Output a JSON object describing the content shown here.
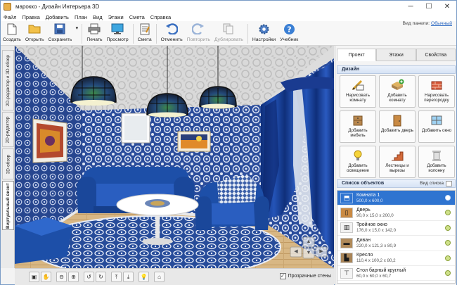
{
  "window": {
    "title": "марокко - Дизайн Интерьера 3D",
    "minimize": "─",
    "maximize": "☐",
    "close": "✕"
  },
  "menu": [
    "Файл",
    "Правка",
    "Добавить",
    "План",
    "Вид",
    "Этажи",
    "Смета",
    "Справка"
  ],
  "toolbar": {
    "view_panel_label": "Вид панели:",
    "view_panel_value": "Обычный",
    "buttons": [
      {
        "label": "Создать",
        "icon": "new-file-icon"
      },
      {
        "label": "Открыть",
        "icon": "open-folder-icon"
      },
      {
        "label": "Сохранить",
        "icon": "save-icon"
      },
      {
        "label": "Печать",
        "icon": "print-icon"
      },
      {
        "label": "Просмотр",
        "icon": "monitor-icon"
      },
      {
        "label": "Смета",
        "icon": "estimate-icon"
      },
      {
        "label": "Отменить",
        "icon": "undo-icon"
      },
      {
        "label": "Повторить",
        "icon": "redo-icon"
      },
      {
        "label": "Дублировать",
        "icon": "duplicate-icon"
      },
      {
        "label": "Настройки",
        "icon": "gear-icon"
      },
      {
        "label": "Учебник",
        "icon": "help-icon"
      }
    ]
  },
  "left_tabs": [
    "2D-редактор и 3D-обзор",
    "2D-редактор",
    "3D-обзор",
    "Виртуальный визит"
  ],
  "right_panel": {
    "tabs": [
      "Проект",
      "Этажи",
      "Свойства"
    ],
    "design_header": "Дизайн",
    "design_buttons": [
      {
        "label": "Нарисовать комнату",
        "icon": "draw-room-icon"
      },
      {
        "label": "Добавить комнату",
        "icon": "add-room-icon"
      },
      {
        "label": "Нарисовать перегородку",
        "icon": "partition-icon"
      },
      {
        "label": "Добавить мебель",
        "icon": "furniture-icon"
      },
      {
        "label": "Добавить дверь",
        "icon": "door-icon"
      },
      {
        "label": "Добавить окно",
        "icon": "window-icon"
      },
      {
        "label": "Добавить освещение",
        "icon": "light-icon"
      },
      {
        "label": "Лестницы и вырезы",
        "icon": "stairs-icon"
      },
      {
        "label": "Добавить колонну",
        "icon": "column-icon"
      }
    ],
    "list_header": "Список объектов",
    "list_view_label": "Вид списка",
    "objects": [
      {
        "name": "Комната 1",
        "dims": "500,0 x 600,0",
        "icon": "room-icon"
      },
      {
        "name": "Дверь",
        "dims": "90,0 x 15,0 x 200,0",
        "icon": "door-icon"
      },
      {
        "name": "Тройное окно",
        "dims": "176,0 x 15,0 x 142,0",
        "icon": "window-icon"
      },
      {
        "name": "Диван",
        "dims": "220,0 x 121,3 x 80,9",
        "icon": "sofa-icon"
      },
      {
        "name": "Кресло",
        "dims": "110,4 x 100,2 x 80,2",
        "icon": "armchair-icon"
      },
      {
        "name": "Стол барный круглый",
        "dims": "60,0 x 60,0 x 60,7",
        "icon": "table-icon"
      }
    ]
  },
  "bottom_bar": {
    "transparent_walls_label": "Прозрачные стены",
    "transparent_walls_checked": true
  },
  "colors": {
    "accent": "#2f74d0",
    "wall_blue": "#2a4fa0",
    "sofa_blue": "#1d4fa8",
    "floor_wood": "#d8b784"
  }
}
